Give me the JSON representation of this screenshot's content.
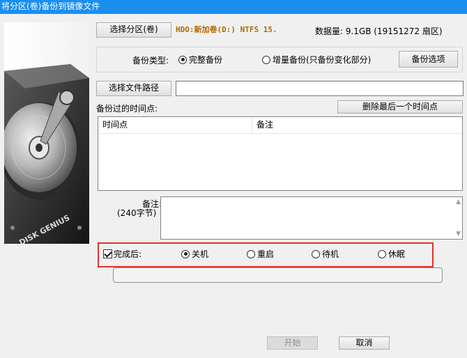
{
  "window": {
    "title": "将分区(卷)备份到镜像文件"
  },
  "source": {
    "select_button": "选择分区(卷)",
    "partition_label": "HDO:新加卷(D:) NTFS 15.",
    "data_amount": "数据量: 9.1GB (19151272 扇区)"
  },
  "backup_type": {
    "label": "备份类型:",
    "full_label": "完整备份",
    "full_selected": true,
    "incremental_label": "增量备份(只备份变化部分)",
    "incremental_selected": false,
    "options_button": "备份选项"
  },
  "file_path": {
    "button": "选择文件路径",
    "value": ""
  },
  "timepoints": {
    "label": "备份过的时间点:",
    "delete_button": "删除最后一个时间点",
    "columns": [
      "时间点",
      "备注"
    ],
    "rows": []
  },
  "note": {
    "label": "备注:",
    "hint": "(240字节)",
    "value": ""
  },
  "after_complete": {
    "checkbox_label": "完成后:",
    "checked": true,
    "options": [
      {
        "label": "关机",
        "selected": true
      },
      {
        "label": "重启",
        "selected": false
      },
      {
        "label": "待机",
        "selected": false
      },
      {
        "label": "休眠",
        "selected": false
      }
    ]
  },
  "image_text": "DISK GENIUS",
  "actions": {
    "start": "开始",
    "start_enabled": false,
    "cancel": "取消"
  },
  "colors": {
    "titlebar": "#1a8ff0",
    "partition_text": "#b06a00",
    "highlight_frame": "#e3302a"
  }
}
